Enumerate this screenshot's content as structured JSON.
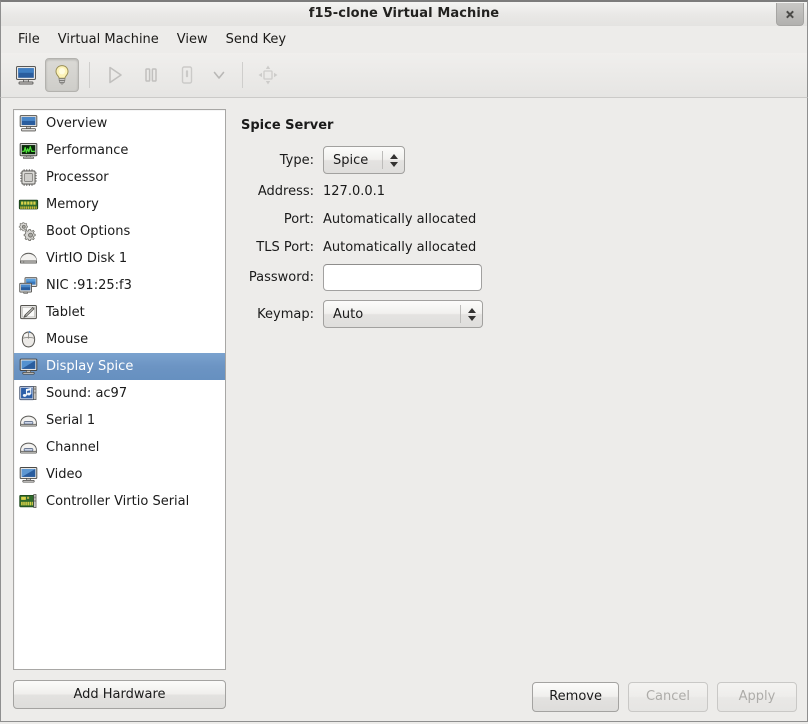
{
  "window": {
    "title": "f15-clone Virtual Machine",
    "close_label": "Close"
  },
  "menubar": {
    "items": [
      {
        "label": "File"
      },
      {
        "label": "Virtual Machine"
      },
      {
        "label": "View"
      },
      {
        "label": "Send Key"
      }
    ]
  },
  "toolbar": {
    "buttons": [
      {
        "name": "show-console-button",
        "icon": "monitor-icon",
        "state": "enabled",
        "tooltip": "Console"
      },
      {
        "name": "show-details-button",
        "icon": "lightbulb-icon",
        "state": "active",
        "tooltip": "Details"
      },
      {
        "name": "run-button",
        "icon": "play-icon",
        "state": "disabled",
        "tooltip": "Run"
      },
      {
        "name": "pause-button",
        "icon": "pause-icon",
        "state": "disabled",
        "tooltip": "Pause"
      },
      {
        "name": "shutdown-button",
        "icon": "power-icon",
        "state": "disabled",
        "tooltip": "Shut Down"
      },
      {
        "name": "shutdown-menu-button",
        "icon": "chevron-down-icon",
        "state": "disabled",
        "tooltip": "Shut Down options"
      },
      {
        "name": "fullscreen-button",
        "icon": "fullscreen-icon",
        "state": "disabled",
        "tooltip": "Fullscreen"
      }
    ]
  },
  "hardware_list": {
    "items": [
      {
        "label": "Overview",
        "icon": "computer-icon",
        "selected": false
      },
      {
        "label": "Performance",
        "icon": "performance-graph-icon",
        "selected": false
      },
      {
        "label": "Processor",
        "icon": "cpu-chip-icon",
        "selected": false
      },
      {
        "label": "Memory",
        "icon": "memory-stick-icon",
        "selected": false
      },
      {
        "label": "Boot Options",
        "icon": "gears-icon",
        "selected": false
      },
      {
        "label": "VirtIO Disk 1",
        "icon": "harddisk-icon",
        "selected": false
      },
      {
        "label": "NIC :91:25:f3",
        "icon": "network-card-icon",
        "selected": false
      },
      {
        "label": "Tablet",
        "icon": "tablet-pen-icon",
        "selected": false
      },
      {
        "label": "Mouse",
        "icon": "mouse-icon",
        "selected": false
      },
      {
        "label": "Display Spice",
        "icon": "display-monitor-icon",
        "selected": true
      },
      {
        "label": "Sound: ac97",
        "icon": "sound-card-icon",
        "selected": false
      },
      {
        "label": "Serial 1",
        "icon": "serial-port-icon",
        "selected": false
      },
      {
        "label": "Channel",
        "icon": "serial-port-icon",
        "selected": false
      },
      {
        "label": "Video",
        "icon": "video-card-icon",
        "selected": false
      },
      {
        "label": "Controller Virtio Serial",
        "icon": "controller-card-icon",
        "selected": false
      }
    ]
  },
  "add_hardware": {
    "label": "Add Hardware"
  },
  "details": {
    "section_title": "Spice Server",
    "fields": {
      "type": {
        "label": "Type:",
        "value": "Spice"
      },
      "address": {
        "label": "Address:",
        "value": "127.0.0.1"
      },
      "port": {
        "label": "Port:",
        "value": "Automatically allocated"
      },
      "tls_port": {
        "label": "TLS Port:",
        "value": "Automatically allocated"
      },
      "password": {
        "label": "Password:",
        "value": "",
        "placeholder": ""
      },
      "keymap": {
        "label": "Keymap:",
        "value": "Auto"
      }
    }
  },
  "actions": {
    "remove": {
      "label": "Remove",
      "enabled": true
    },
    "cancel": {
      "label": "Cancel",
      "enabled": false
    },
    "apply": {
      "label": "Apply",
      "enabled": false
    }
  },
  "colors": {
    "selection_blue": "#6c94c3",
    "window_bg": "#edecea",
    "list_bg": "#ffffff",
    "text": "#1a1a1a",
    "disabled_text": "#adaca9"
  }
}
